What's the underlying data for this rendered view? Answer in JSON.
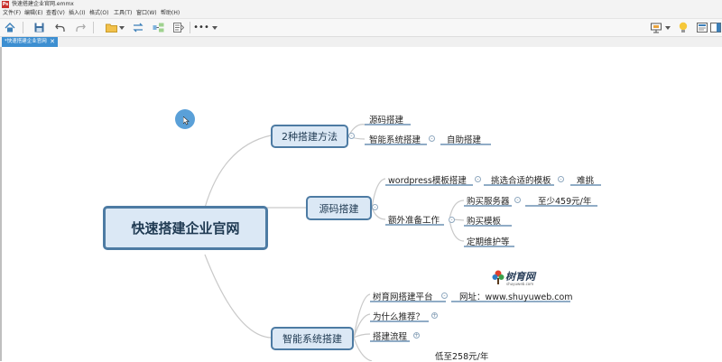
{
  "window": {
    "title": "快速搭建企业官网.emmx",
    "app_icon_text": "Ps"
  },
  "menu": [
    "文件(F)",
    "编辑(E)",
    "查看(V)",
    "插入(I)",
    "格式(O)",
    "工具(T)",
    "窗口(W)",
    "帮助(H)"
  ],
  "tab": {
    "label": "*快速搭建企业官网",
    "close": "✕"
  },
  "colors": {
    "accent": "#3d8fd1",
    "node_fill": "#dbe8f5",
    "node_border": "#4d7ba3",
    "line": "#c9c9c9",
    "underline": "#4d7ba3",
    "cursor": "#3d8fd1"
  },
  "mindmap": {
    "root": "快速搭建企业官网",
    "branches": [
      {
        "label": "2种搭建方法",
        "children": [
          "源码搭建",
          "智能系统搭建",
          "自助搭建"
        ]
      },
      {
        "label": "源码搭建",
        "children": [
          "wordpress模板搭建",
          "挑选合适的模板",
          "难挑",
          "额外准备工作",
          "购买服务器",
          "至少459元/年",
          "购买模板",
          "定期维护等"
        ]
      },
      {
        "label": "智能系统搭建",
        "children": [
          "树育网搭建平台",
          "网址：www.shuyuweb.com",
          "为什么推荐？",
          "搭建流程",
          "低至258元/年"
        ]
      }
    ],
    "logo": {
      "brand": "树育网",
      "domain": "shuyuweb.com"
    }
  }
}
